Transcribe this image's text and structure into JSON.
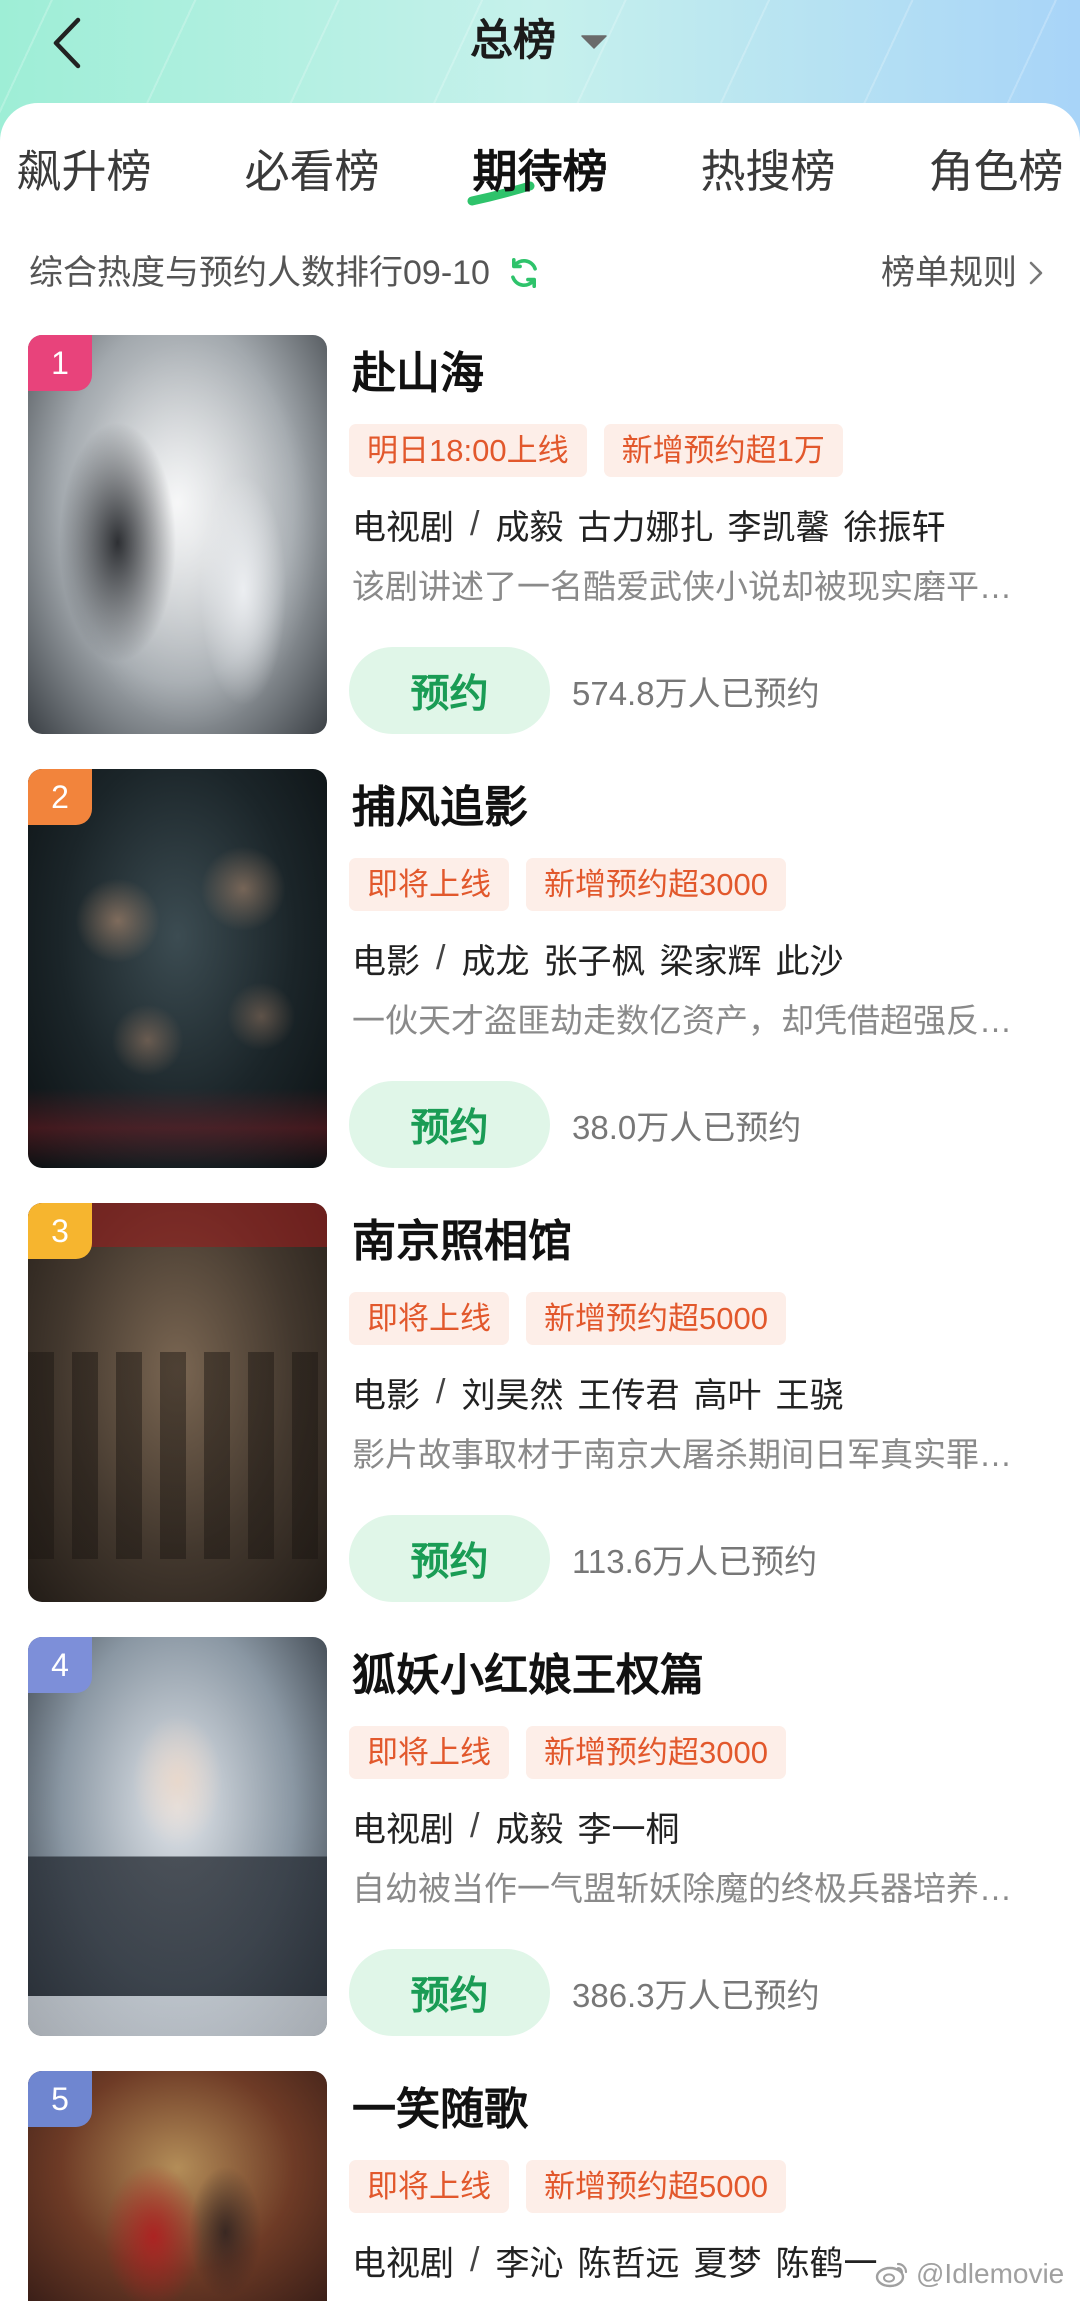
{
  "header": {
    "title": "总榜",
    "back_icon": "chevron-left-icon",
    "dropdown_icon": "caret-down-icon"
  },
  "tabs": [
    {
      "label": "飙升榜",
      "active": false
    },
    {
      "label": "必看榜",
      "active": false
    },
    {
      "label": "期待榜",
      "active": true
    },
    {
      "label": "热搜榜",
      "active": false
    },
    {
      "label": "角色榜",
      "active": false
    }
  ],
  "ranking_info": {
    "description": "综合热度与预约人数排行09-10",
    "refresh_icon": "refresh-icon",
    "rules_label": "榜单规则",
    "rules_icon": "chevron-right-icon"
  },
  "meta_separator": "/",
  "items": [
    {
      "rank": "1",
      "title": "赴山海",
      "tags": [
        "明日18:00上线",
        "新增预约超1万"
      ],
      "category": "电视剧",
      "cast": [
        "成毅",
        "古力娜扎",
        "李凯馨",
        "徐振轩"
      ],
      "description": "该剧讲述了一名酷爱武侠小说却被现实磨平…",
      "button_label": "预约",
      "reservation_count": "574.8万人已预约",
      "badge_color": "#e8437b",
      "poster_palette": [
        "#f3f4f5",
        "#a3a9ae",
        "#3b4045"
      ]
    },
    {
      "rank": "2",
      "title": "捕风追影",
      "tags": [
        "即将上线",
        "新增预约超3000"
      ],
      "category": "电影",
      "cast": [
        "成龙",
        "张子枫",
        "梁家辉",
        "此沙"
      ],
      "description": "一伙天才盗匪劫走数亿资产，却凭借超强反…",
      "button_label": "预约",
      "reservation_count": "38.0万人已预约",
      "badge_color": "#f2843c",
      "poster_palette": [
        "#3c4c52",
        "#1b2529",
        "#0b1012"
      ]
    },
    {
      "rank": "3",
      "title": "南京照相馆",
      "tags": [
        "即将上线",
        "新增预约超5000"
      ],
      "category": "电影",
      "cast": [
        "刘昊然",
        "王传君",
        "高叶",
        "王骁"
      ],
      "description": "影片故事取材于南京大屠杀期间日军真实罪…",
      "button_label": "预约",
      "reservation_count": "113.6万人已预约",
      "badge_color": "#f6b52f",
      "poster_palette": [
        "#7a6652",
        "#43382e",
        "#221c17"
      ]
    },
    {
      "rank": "4",
      "title": "狐妖小红娘王权篇",
      "tags": [
        "即将上线",
        "新增预约超3000"
      ],
      "category": "电视剧",
      "cast": [
        "成毅",
        "李一桐"
      ],
      "description": "自幼被当作一气盟斩妖除魔的终极兵器培养…",
      "button_label": "预约",
      "reservation_count": "386.3万人已预约",
      "badge_color": "#7d8fd9",
      "poster_palette": [
        "#e2e6eb",
        "#8a97a3",
        "#2c333b"
      ]
    },
    {
      "rank": "5",
      "title": "一笑随歌",
      "tags": [
        "即将上线",
        "新增预约超5000"
      ],
      "category": "电视剧",
      "cast": [
        "李沁",
        "陈哲远",
        "夏梦",
        "陈鹤一"
      ],
      "badge_color": "#6f86d0",
      "poster_palette": [
        "#b38d58",
        "#6e3b26",
        "#3b1f18"
      ]
    }
  ],
  "watermark": {
    "icon": "weibo-icon",
    "text": "@Idlemovie"
  },
  "colors": {
    "accent_green": "#2ec36b",
    "reserve_button_bg": "#e0f6e8",
    "reserve_button_text": "#1a9c55",
    "tag_bg": "#fdeee8",
    "tag_text": "#e2582c",
    "header_gradient": [
      "#9eeed6",
      "#c6f1ec",
      "#a8d4f8"
    ]
  }
}
